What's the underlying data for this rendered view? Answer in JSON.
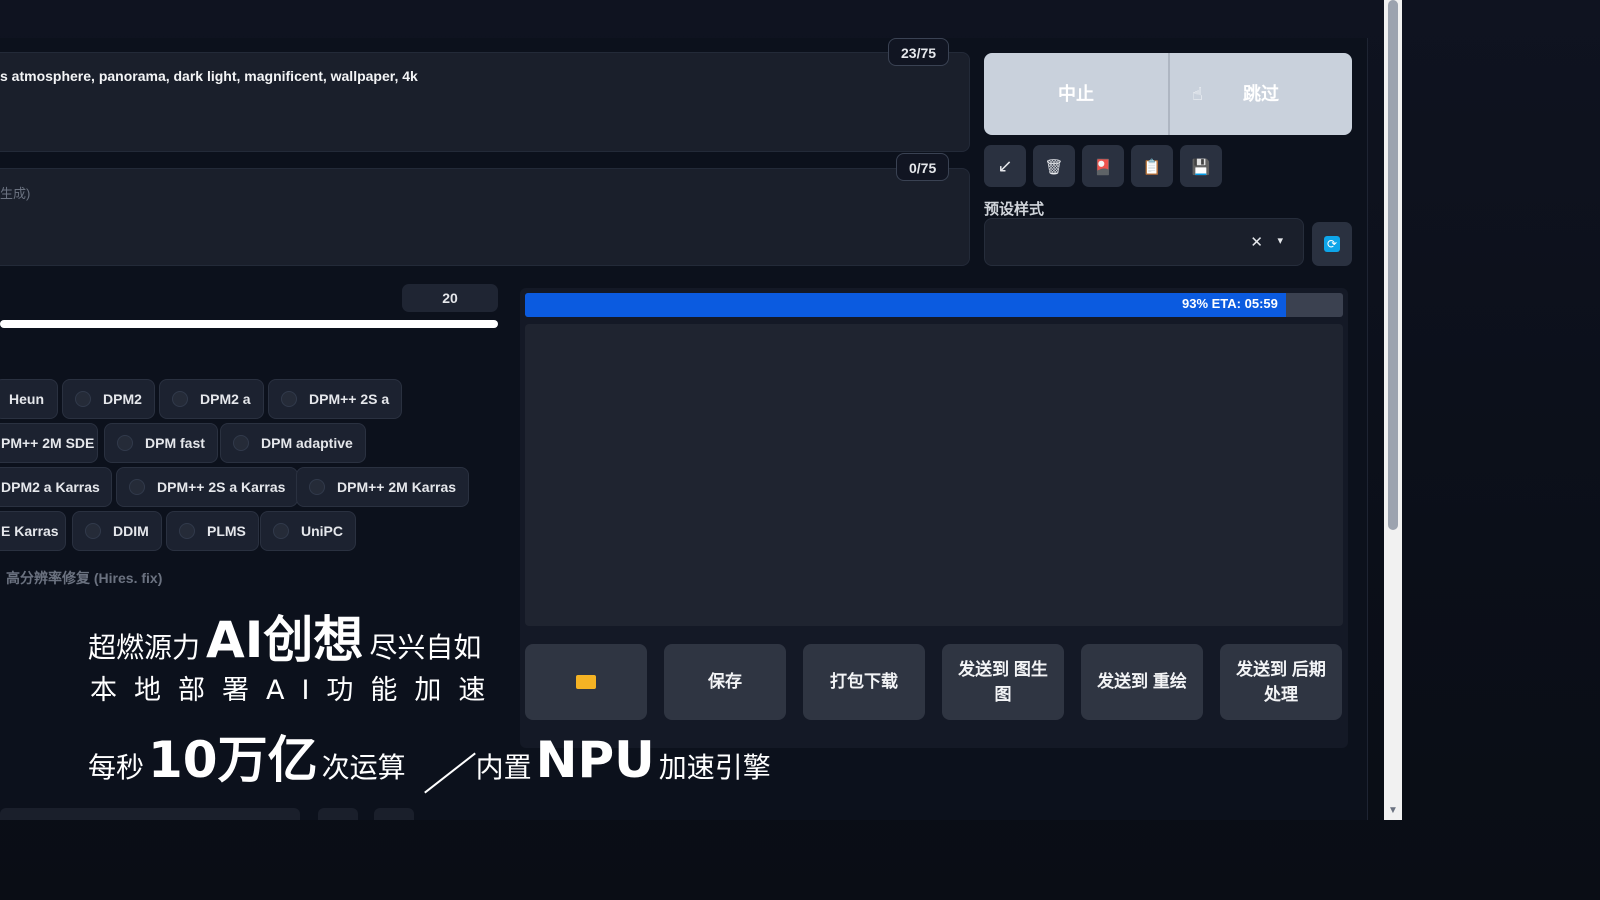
{
  "prompt": {
    "text": "s atmosphere, panorama, dark light, magnificent, wallpaper, 4k",
    "token_counter": "23/75"
  },
  "negative_prompt": {
    "placeholder_fragment": "生成)",
    "token_counter": "0/75"
  },
  "controls": {
    "interrupt_label": "中止",
    "skip_label": "跳过",
    "tools": [
      {
        "icon": "arrow-icon",
        "glyph": "↙"
      },
      {
        "icon": "trash-icon",
        "glyph": "🗑"
      },
      {
        "icon": "style-icon",
        "glyph": "🎴"
      },
      {
        "icon": "clipboard-icon",
        "glyph": "📋"
      },
      {
        "icon": "save-icon",
        "glyph": "💾"
      }
    ],
    "preset_label": "预设样式",
    "preset_clear": "✕",
    "preset_chevron": "▾",
    "refresh_glyph": "⟳"
  },
  "steps": {
    "value": "20"
  },
  "samplers": {
    "row1": [
      "Heun",
      "DPM2",
      "DPM2 a",
      "DPM++ 2S a"
    ],
    "row2": [
      "PM++ 2M SDE",
      "DPM fast",
      "DPM adaptive"
    ],
    "row3": [
      "DPM2 a Karras",
      "DPM++ 2S a Karras",
      "DPM++ 2M Karras"
    ],
    "row4": [
      "E Karras",
      "DDIM",
      "PLMS",
      "UniPC"
    ]
  },
  "hires_label": "高分辨率修复 (Hires. fix)",
  "progress": {
    "fraction": 0.93,
    "text": "93% ETA: 05:59"
  },
  "actions": {
    "save": "保存",
    "zip": "打包下载",
    "to_img2img": "发送到 图生图",
    "to_inpaint": "发送到 重绘",
    "to_extras": "发送到 后期处理"
  },
  "promo": {
    "l1a": "超燃源力",
    "l1b": "AI创想",
    "l1c": "尽兴自如",
    "l2": "本地部署AI功能加速",
    "l3a": "每秒",
    "l3b": "10万亿",
    "l3c": "次运算",
    "l3d": "内置",
    "l3e": "NPU",
    "l3f": "加速引擎"
  }
}
